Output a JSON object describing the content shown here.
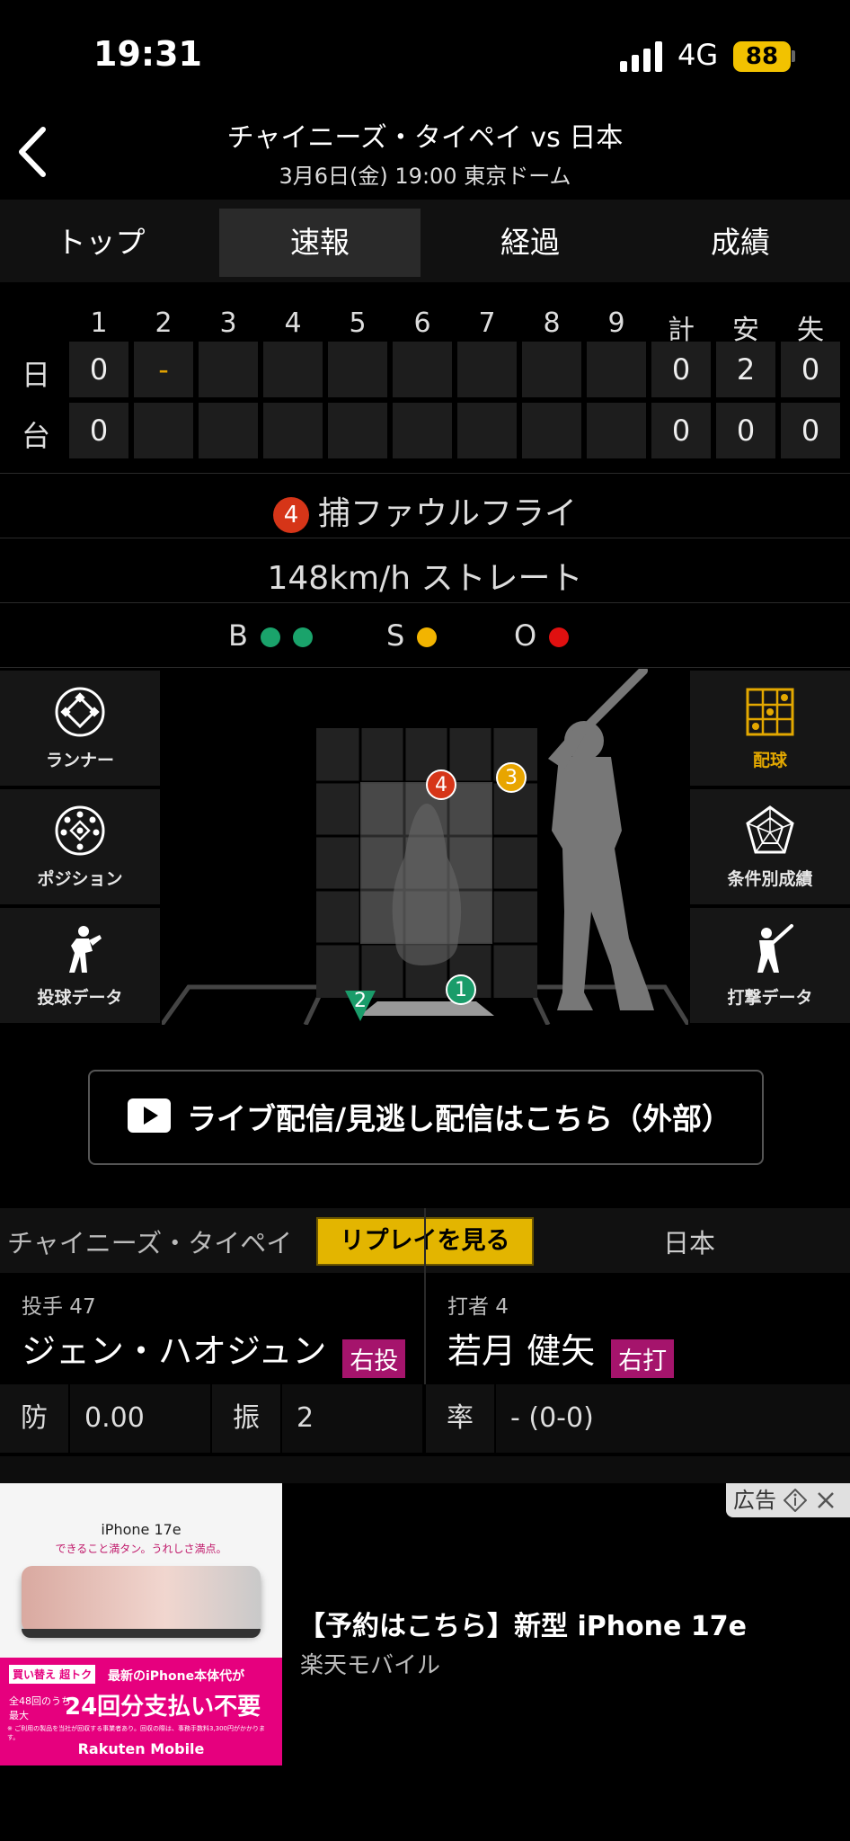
{
  "status": {
    "time": "19:31",
    "network": "4G",
    "battery": "88"
  },
  "header": {
    "title": "チャイニーズ・タイペイ vs 日本",
    "subtitle": "3月6日(金) 19:00 東京ドーム"
  },
  "tabs": [
    {
      "label": "トップ",
      "active": false
    },
    {
      "label": "速報",
      "active": true
    },
    {
      "label": "経過",
      "active": false
    },
    {
      "label": "成績",
      "active": false
    }
  ],
  "scoreboard": {
    "columns": [
      "1",
      "2",
      "3",
      "4",
      "5",
      "6",
      "7",
      "8",
      "9",
      "計",
      "安",
      "失"
    ],
    "rows": [
      {
        "team": "日",
        "cells": [
          "0",
          "-",
          "",
          "",
          "",
          "",
          "",
          "",
          "",
          "0",
          "2",
          "0"
        ]
      },
      {
        "team": "台",
        "cells": [
          "0",
          "",
          "",
          "",
          "",
          "",
          "",
          "",
          "",
          "0",
          "0",
          "0"
        ]
      }
    ],
    "current_marker_color": "#e0a000"
  },
  "play": {
    "pitch_number": "4",
    "result": "捕ファウルフライ",
    "pitch": "148km/h ストレート"
  },
  "count": {
    "ball_label": "B",
    "balls": 2,
    "ball_color": "#1aa36b",
    "strike_label": "S",
    "strikes": 1,
    "strike_color": "#f2b400",
    "out_label": "O",
    "outs": 1,
    "out_color": "#e01010"
  },
  "left_menu": [
    "ランナー",
    "ポジション",
    "投球データ"
  ],
  "right_menu": [
    "配球",
    "条件別成績",
    "打撃データ"
  ],
  "pitches": [
    {
      "num": "4",
      "color": "#d63518",
      "shape": "circle"
    },
    {
      "num": "3",
      "color": "#e8a500",
      "shape": "circle"
    },
    {
      "num": "1",
      "color": "#1a9c6a",
      "shape": "circle"
    },
    {
      "num": "2",
      "color": "#1a9c6a",
      "shape": "triangle"
    }
  ],
  "stream_button": "ライブ配信/見逃し配信はこちら（外部）",
  "matchup": {
    "away_team": "チャイニーズ・タイペイ",
    "replay_label": "リプレイを見る",
    "home_team": "日本",
    "pitcher": {
      "label": "投手 47",
      "name": "ジェン・ハオジュン",
      "hand": "右投"
    },
    "batter": {
      "label": "打者 4",
      "name": "若月 健矢",
      "hand": "右打"
    },
    "stats": [
      {
        "key": "防",
        "value": "0.00"
      },
      {
        "key": "振",
        "value": "2"
      },
      {
        "key": "率",
        "value": "- (0-0)"
      }
    ]
  },
  "ad": {
    "tag": "広告",
    "title": "【予約はこちら】新型 iPhone 17e",
    "sponsor": "楽天モバイル",
    "creative": {
      "product": "iPhone 17e",
      "tagline": "できること満タン。うれしさ満点。",
      "promo1": "買い替え 超トク",
      "promo2": "最新のiPhone本体代が",
      "promo3": "全48回のうち 最大",
      "promo4": "24回分支払い不要",
      "note": "※ ご利用の製品を当社が回収する事業者あり。回収の際は、事務手数料3,300円がかかります。",
      "brand": "Rakuten Mobile"
    }
  }
}
